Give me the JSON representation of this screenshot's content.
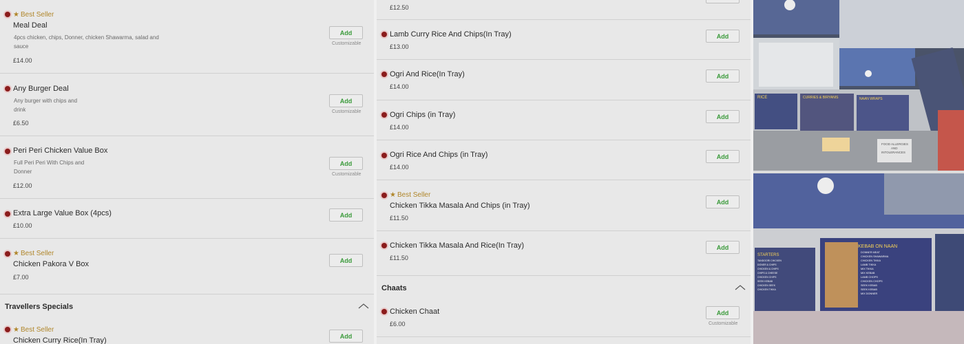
{
  "left_panel": {
    "items": [
      {
        "best_seller": "Best Seller",
        "name": "Meal Deal",
        "desc": [
          "4pcs chicken, chips, Donner, chicken Shawarma, salad and",
          "sauce"
        ],
        "price": "£14.00",
        "add": "Add",
        "custom": "Customizable"
      },
      {
        "name": "Any Burger Deal",
        "desc": [
          "Any burger with chips and",
          "drink"
        ],
        "price": "£6.50",
        "add": "Add",
        "custom": "Customizable"
      },
      {
        "name": "Peri Peri Chicken Value Box",
        "desc": [
          "Full Peri Peri With Chips and",
          "Donner"
        ],
        "price": "£12.00",
        "add": "Add",
        "custom": "Customizable"
      },
      {
        "name": "Extra Large Value Box (4pcs)",
        "price": "£10.00",
        "add": "Add"
      },
      {
        "best_seller": "Best Seller",
        "name": "Chicken Pakora V Box",
        "price": "£7.00",
        "add": "Add"
      }
    ],
    "section": "Travellers Specials",
    "next_item": {
      "best_seller": "Best Seller",
      "name": "Chicken Curry Rice(In Tray)",
      "add": "Add"
    }
  },
  "mid_panel": {
    "top_price": "£12.50",
    "items": [
      {
        "name": "Lamb Curry Rice And Chips(In Tray)",
        "price": "£13.00",
        "add": "Add"
      },
      {
        "name": "Ogri And Rice(In Tray)",
        "price": "£14.00",
        "add": "Add"
      },
      {
        "name": "Ogri Chips (in Tray)",
        "price": "£14.00",
        "add": "Add"
      },
      {
        "name": "Ogri Rice And Chips (in Tray)",
        "price": "£14.00",
        "add": "Add"
      },
      {
        "best_seller": "Best Seller",
        "name": "Chicken Tikka Masala And Chips (in Tray)",
        "price": "£11.50",
        "add": "Add"
      },
      {
        "name": "Chicken Tikka Masala And Rice(In Tray)",
        "price": "£11.50",
        "add": "Add"
      }
    ],
    "section": "Chaats",
    "chaat": {
      "name": "Chicken Chaat",
      "price": "£6.00",
      "add": "Add",
      "custom": "Customizable"
    }
  },
  "photos": {
    "photo1": {
      "boards": [
        "RICE",
        "CURRIES & BIRYANIS",
        "NAAN WRAPS"
      ],
      "sign": [
        "FOOD ALLERGIES",
        "AND",
        "INTOLERANCES"
      ]
    },
    "photo2": {
      "boards": [
        "STARTERS",
        "KEBAB ON NAAN"
      ],
      "starters": [
        "TANDOORI CHICKEN",
        "DONER & CHIPS",
        "CHICKEN & CHIPS",
        "CHIPS & CHEESE",
        "CHICKEN CHIPS",
        "SEEK KEBAB",
        "CHICKEN SEEK",
        "CHICKEN TIKKA"
      ],
      "kebab": [
        "DONNER MEAT",
        "CHICKEN SHAWARMA",
        "CHICKEN TIKKA",
        "LAMB TIKKA",
        "MIX TIKKA",
        "MIX KEBAB",
        "LAMB CHOPS",
        "CHICKEN CHOPS",
        "SEEK KEBAB",
        "SEEK KEBAB",
        "MIX DONNER"
      ]
    }
  },
  "colors": {
    "veg_marker": "#8b1c1c",
    "best_seller": "#b0862a",
    "add_text": "#3a9a3a"
  }
}
